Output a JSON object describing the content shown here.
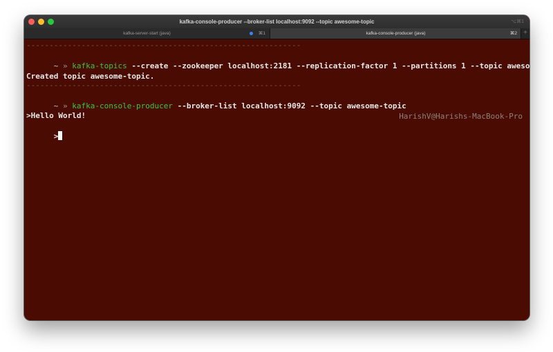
{
  "window": {
    "title": "kafka-console-producer --broker-list localhost:9092 --topic awesome-topic",
    "shortcut": "⌥⌘1",
    "traffic_lights": {
      "close": "#ff5f57",
      "minimize": "#febc2e",
      "zoom": "#28c840"
    }
  },
  "tabs": [
    {
      "label": "kafka-server-start (java)",
      "shortcut": "⌘1",
      "activity_dot_color": "#3c82f6"
    },
    {
      "label": "kafka-console-producer (java)",
      "shortcut": "⌘2"
    }
  ],
  "new_tab_icon": "plus-icon",
  "colors": {
    "background": "#4a0c02",
    "command": "#39c634",
    "text": "#e6e6e6"
  },
  "terminal": {
    "separator": "------------------------------------------------------------",
    "lines": [
      {
        "prompt": "~",
        "arrow": "»",
        "command": "kafka-topics",
        "args": " --create --zookeeper localhost:2181 --replication-factor 1 --partitions 1 --topic awesome-topic"
      },
      {
        "output": "Created topic awesome-topic."
      },
      {
        "prompt": "~",
        "arrow": "»",
        "command": "kafka-console-producer",
        "args": " --broker-list localhost:9092 --topic awesome-topic",
        "right_prompt": "HarishV@Harishs-MacBook-Pro"
      },
      {
        "output": ">Hello World!"
      },
      {
        "output": ">"
      }
    ]
  }
}
